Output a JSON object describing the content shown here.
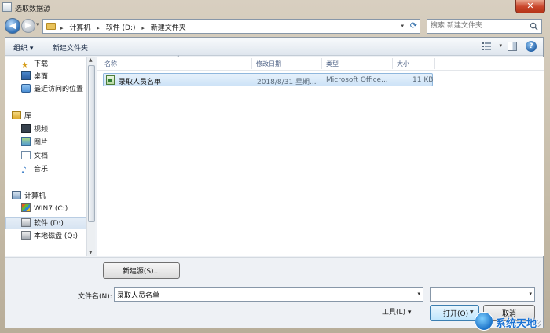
{
  "window": {
    "title": "选取数据源",
    "close_symbol": "✕"
  },
  "address": {
    "back_symbol": "◀",
    "forward_symbol": "▶",
    "crumbs": [
      "计算机",
      "软件 (D:)",
      "新建文件夹"
    ],
    "crumb_separator": "▸",
    "search_placeholder": "搜索 新建文件夹"
  },
  "toolbar": {
    "organize_label": "组织 ▾",
    "new_folder_label": "新建文件夹",
    "view_drop": "▾",
    "help_symbol": "?"
  },
  "nav": {
    "favorites": [
      {
        "label": "下载",
        "icon": "download-icon"
      },
      {
        "label": "桌面",
        "icon": "desktop-icon"
      },
      {
        "label": "最近访问的位置",
        "icon": "recent-places-icon"
      }
    ],
    "libraries_label": "库",
    "libraries": [
      {
        "label": "视频",
        "icon": "video-icon"
      },
      {
        "label": "图片",
        "icon": "pictures-icon"
      },
      {
        "label": "文档",
        "icon": "documents-icon"
      },
      {
        "label": "音乐",
        "icon": "music-icon"
      }
    ],
    "computer_label": "计算机",
    "drives": [
      {
        "label": "WIN7 (C:)",
        "icon": "system-drive-icon"
      },
      {
        "label": "软件 (D:)",
        "icon": "drive-icon",
        "selected": true
      },
      {
        "label": "本地磁盘 (Q:)",
        "icon": "drive-icon"
      }
    ]
  },
  "columns": {
    "name": "名称",
    "date": "修改日期",
    "type": "类型",
    "size": "大小"
  },
  "files": [
    {
      "name": "录取人员名单",
      "date": "2018/8/31 星期...",
      "type": "Microsoft Office...",
      "size": "11 KB"
    }
  ],
  "bottom": {
    "new_source_label": "新建源(S)...",
    "filename_label": "文件名(N):",
    "filename_value": "录取人员名单",
    "tools_label": "工具(L) ▾",
    "open_label": "打开(O)",
    "cancel_label": "取消"
  },
  "watermark": {
    "text": "系统天地"
  },
  "colors": {
    "selection": "#cde3f7",
    "close": "#c9452a",
    "accent": "#2f6fb5"
  }
}
